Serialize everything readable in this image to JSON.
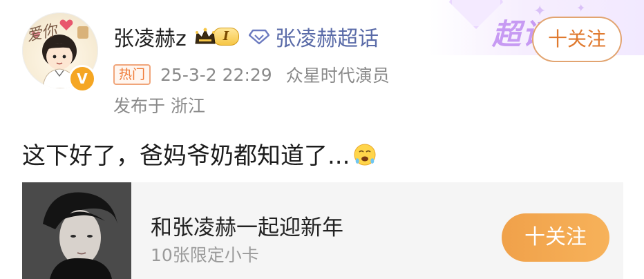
{
  "post": {
    "user": {
      "name": "张凌赫z",
      "level_badge": "I",
      "verified_badge": "V",
      "avatar_text": "爱你"
    },
    "topic": "张凌赫超话",
    "super_topic_decoration": "超话",
    "follow_label": "十关注",
    "hot_tag": "热门",
    "timestamp": "25-3-2 22:29",
    "source": "众星时代演员",
    "location": "发布于 浙江",
    "content": "这下好了，爸妈爷奶都知道了..."
  },
  "card": {
    "title": "和张凌赫一起迎新年",
    "subtitle": "10张限定小卡",
    "follow_label": "十关注"
  },
  "colors": {
    "accent_orange": "#f0a14a",
    "topic_blue": "#5a6ba8",
    "meta_gray": "#8a8a8a",
    "deco_purple": "#c79af3"
  },
  "icons": {
    "crown": "crown-icon",
    "topic": "diamond-icon",
    "emoji": "worried-face-emoji"
  }
}
